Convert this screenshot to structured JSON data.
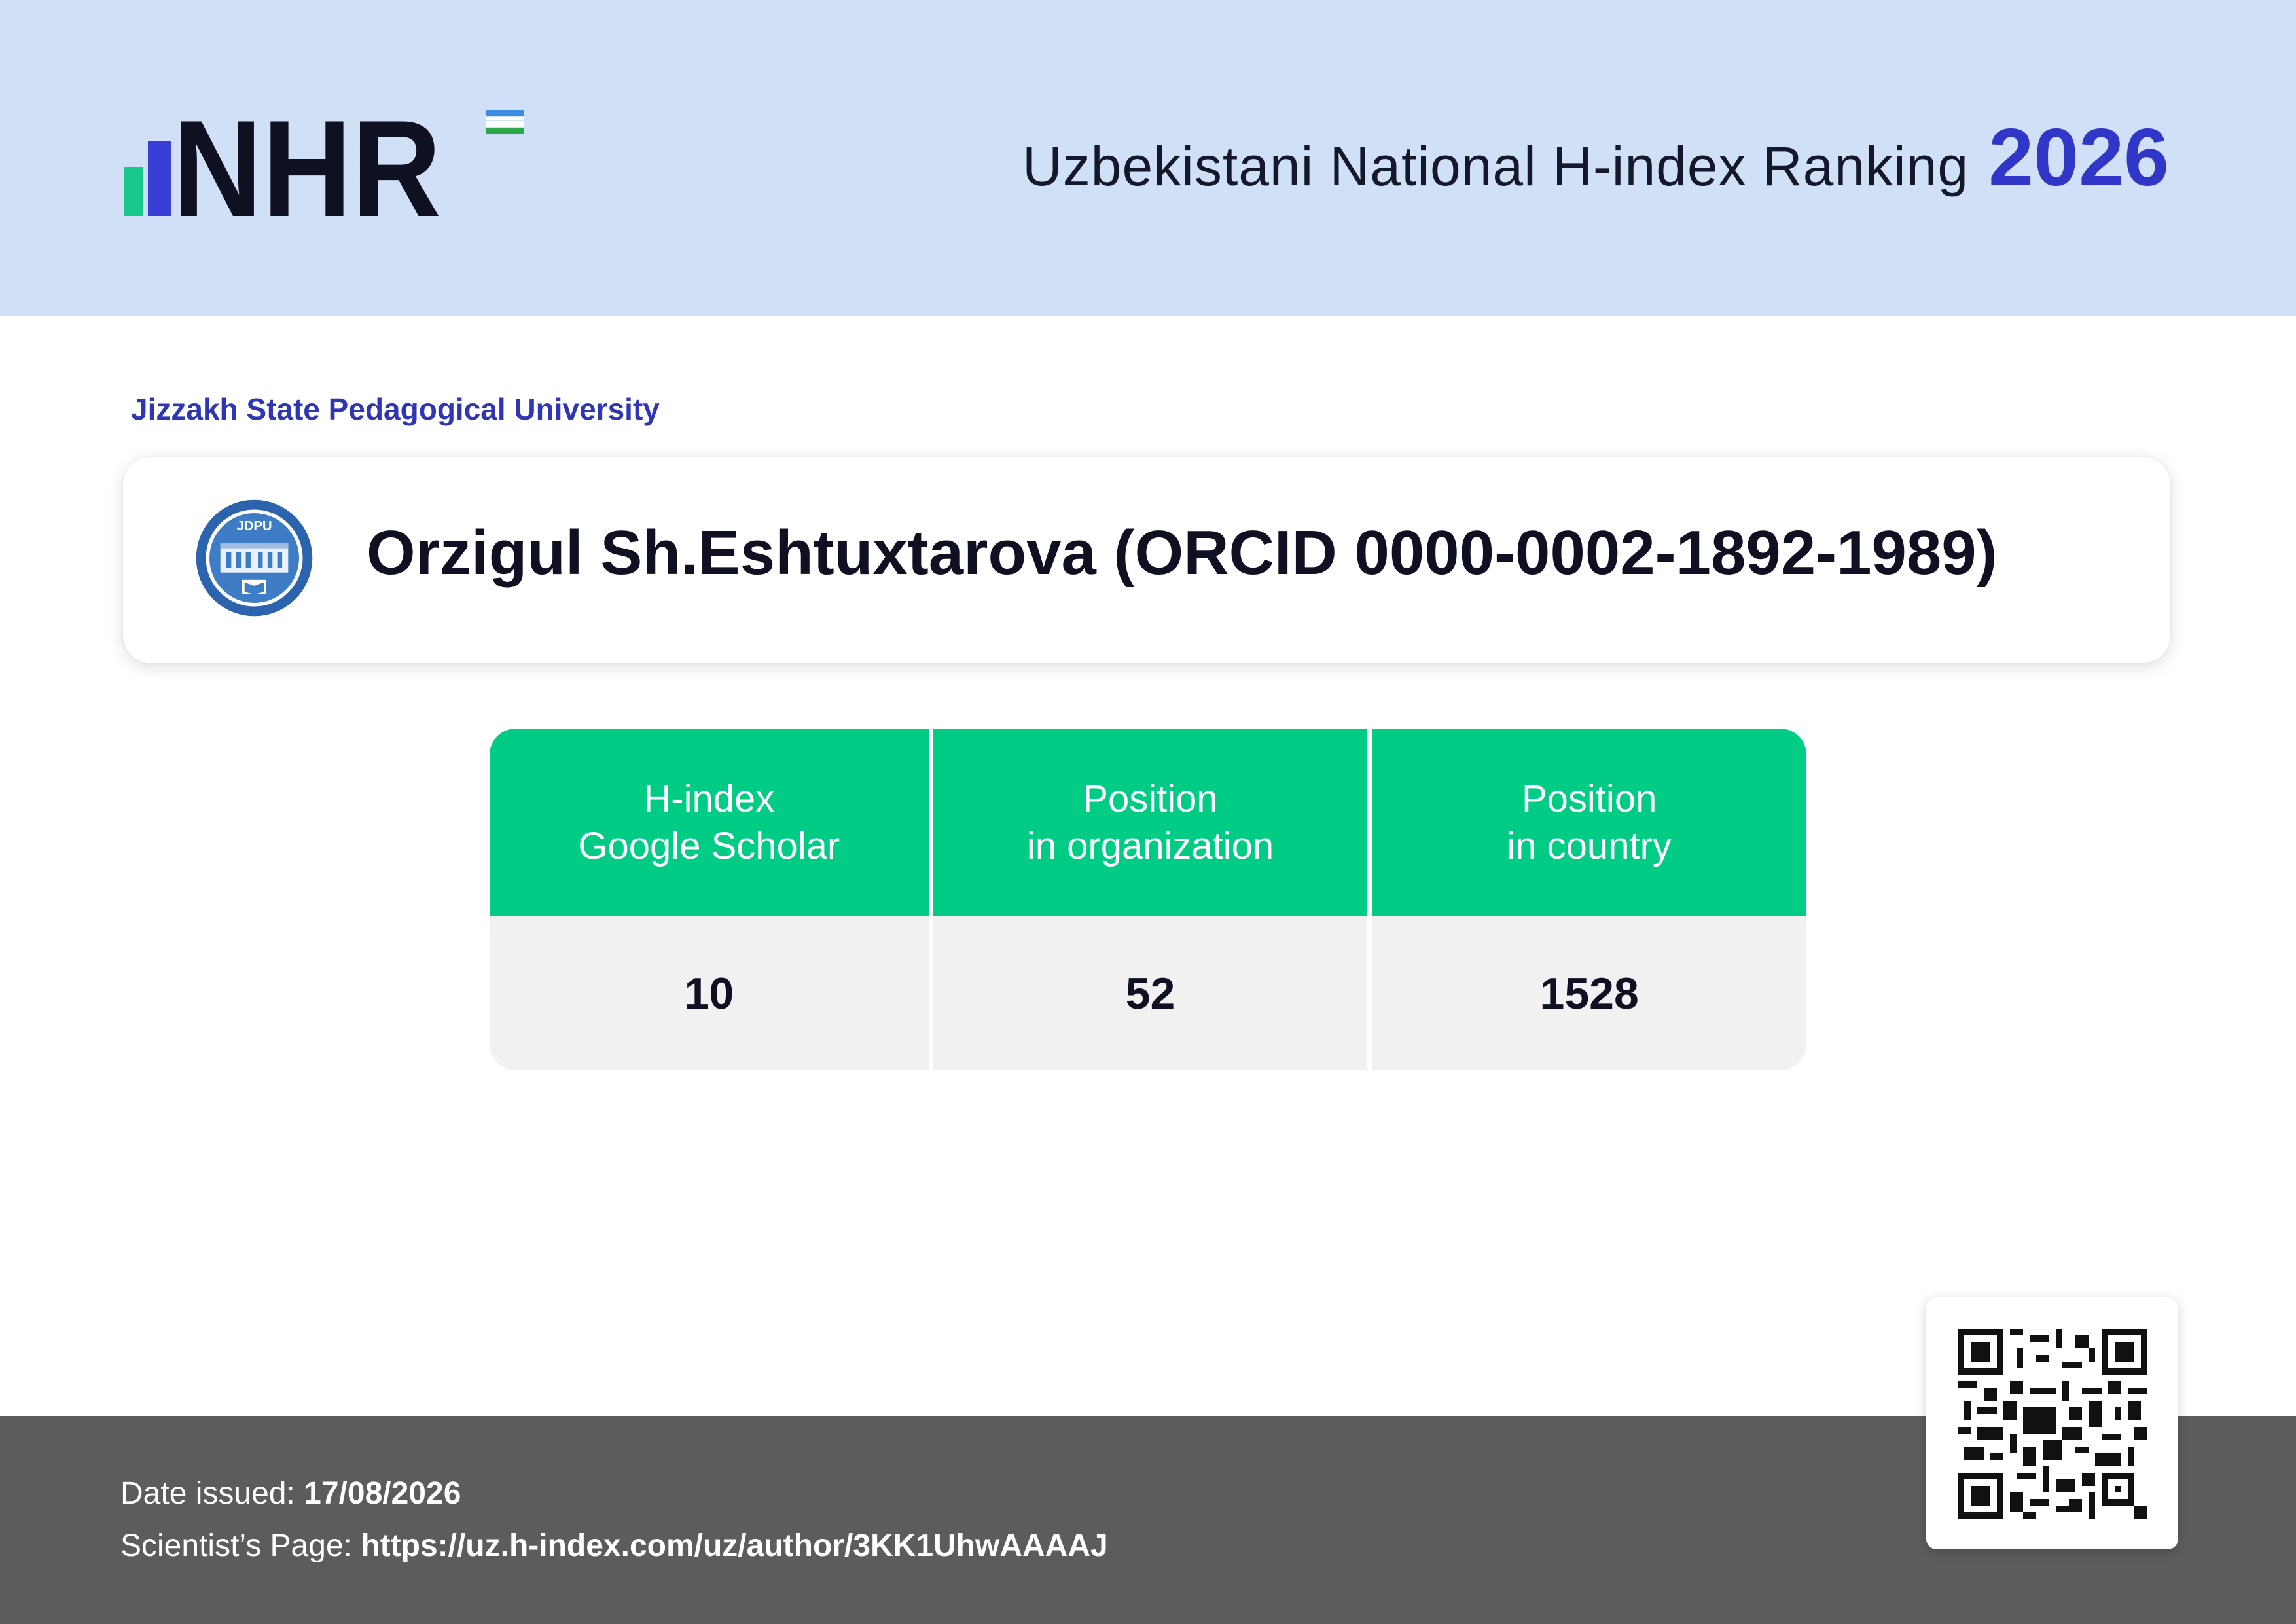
{
  "header": {
    "logo_text": "NHR",
    "title": "Uzbekistani National H-index Ranking",
    "year": "2026"
  },
  "organization": "Jizzakh State Pedagogical University",
  "seal": {
    "abbr": "JDPU"
  },
  "scientist": {
    "name": "Orzigul Sh.Eshtuxtarova (ORCID 0000-0002-1892-1989)"
  },
  "stats": {
    "columns": [
      {
        "label": "H-index\nGoogle Scholar",
        "value": "10"
      },
      {
        "label": "Position\nin organization",
        "value": "52"
      },
      {
        "label": "Position\nin country",
        "value": "1528"
      }
    ]
  },
  "footer": {
    "date_label": "Date issued:",
    "date_value": "17/08/2026",
    "page_label": "Scientist’s Page:",
    "page_url": "https://uz.h-index.com/uz/author/3KK1UhwAAAAJ"
  },
  "colors": {
    "header_bg": "#cfe0f7",
    "accent_blue": "#3236c8",
    "accent_green": "#00cc86",
    "footer_bg": "#5c5c5c"
  }
}
